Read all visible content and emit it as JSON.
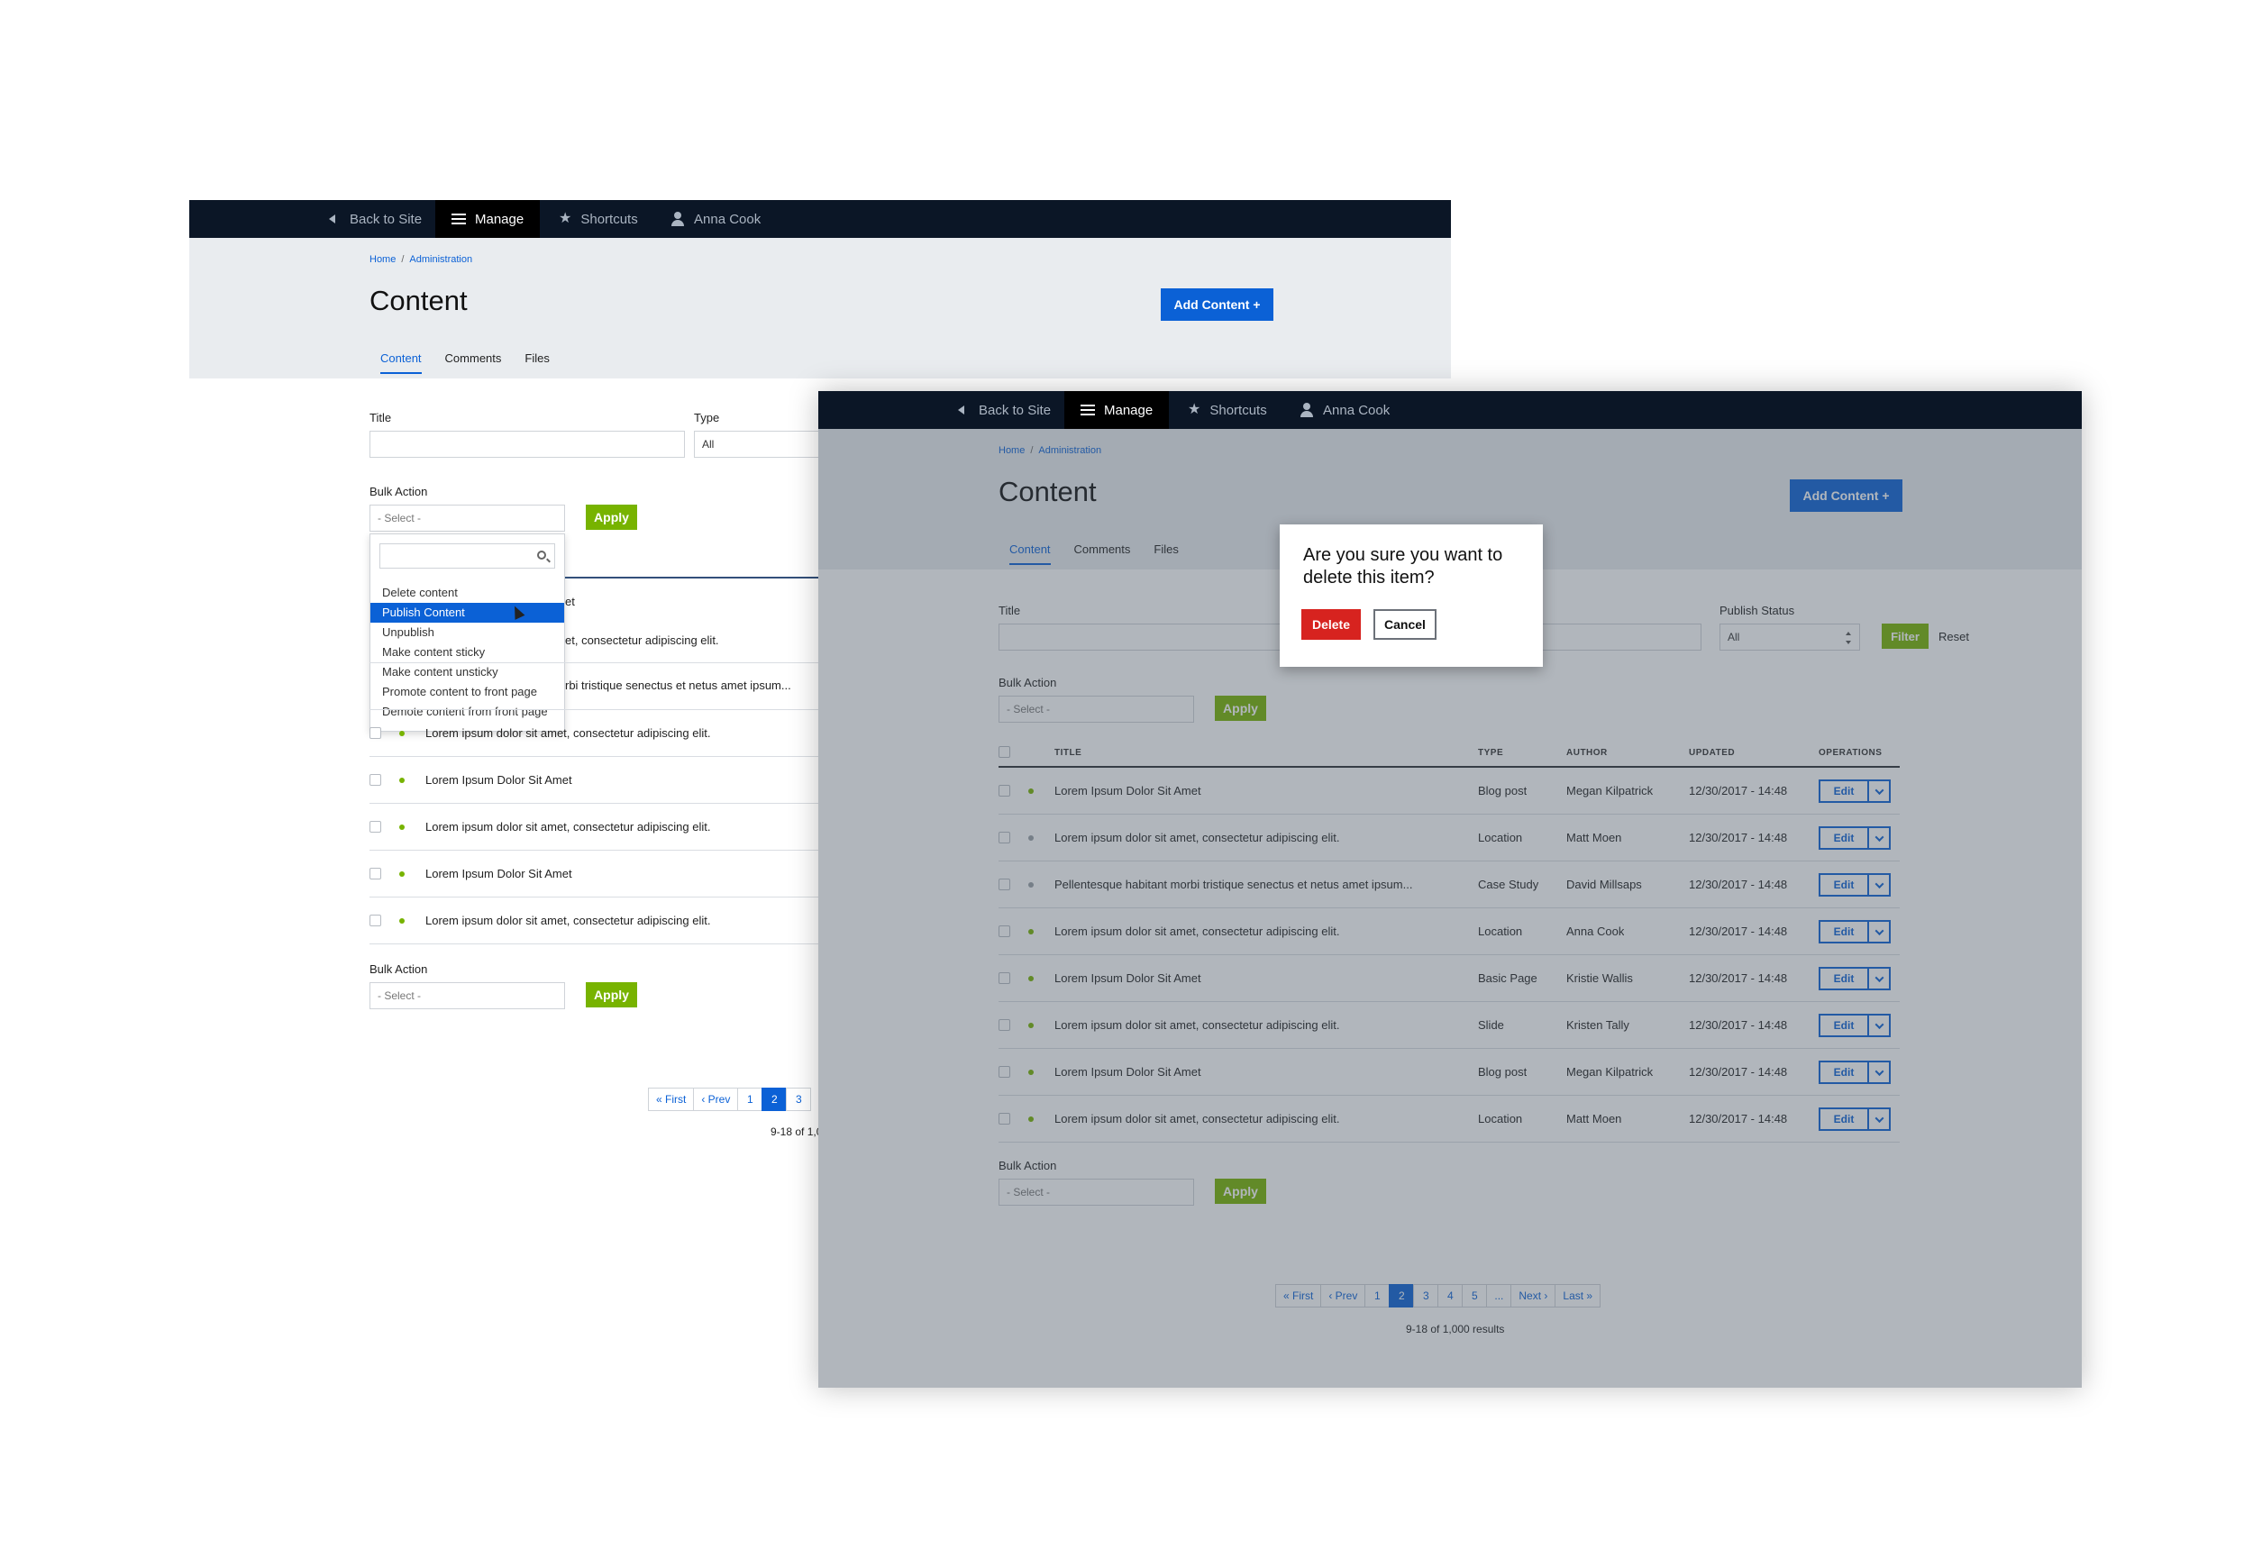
{
  "toolbar": {
    "back": "Back to Site",
    "manage": "Manage",
    "shortcuts": "Shortcuts",
    "user": "Anna Cook"
  },
  "breadcrumb": {
    "home": "Home",
    "admin": "Administration"
  },
  "page_title": "Content",
  "add_content": "Add Content +",
  "tabs": {
    "content": "Content",
    "comments": "Comments",
    "files": "Files"
  },
  "filters": {
    "title_label": "Title",
    "type_label": "Type",
    "type_value": "All",
    "status_label": "Publish Status",
    "status_value": "All",
    "filter": "Filter",
    "reset": "Reset"
  },
  "bulk": {
    "label": "Bulk Action",
    "placeholder": "- Select -",
    "apply": "Apply"
  },
  "dropdown_items": [
    "Delete content",
    "Publish Content",
    "Unpublish",
    "Make content sticky",
    "Make content unsticky",
    "Promote content to front page",
    "Demote content from front page"
  ],
  "back_rows": {
    "header_fragment": "et",
    "r1": "et, consectetur adipiscing elit.",
    "r2": "rbi tristique senectus et netus amet ipsum...",
    "r3": "Lorem ipsum dolor sit amet, consectetur adipiscing elit.",
    "r4": "Lorem Ipsum Dolor Sit Amet",
    "r5": "Lorem ipsum dolor sit amet, consectetur adipiscing elit.",
    "r6": "Lorem Ipsum Dolor Sit Amet",
    "r7": "Lorem ipsum dolor sit amet, consectetur adipiscing elit."
  },
  "back_pager": {
    "first": "« First",
    "prev": "‹ Prev",
    "p1": "1",
    "p2": "2",
    "p3": "3",
    "results": "9-18 of 1,0"
  },
  "table_headers": {
    "title": "TITLE",
    "type": "TYPE",
    "author": "AUTHOR",
    "updated": "UPDATED",
    "operations": "OPERATIONS"
  },
  "rows": [
    {
      "title": "Lorem Ipsum Dolor Sit Amet",
      "type": "Blog post",
      "author": "Megan Kilpatrick",
      "updated": "12/30/2017 - 14:48"
    },
    {
      "title": "Lorem ipsum dolor sit amet, consectetur adipiscing elit.",
      "type": "Location",
      "author": "Matt Moen",
      "updated": "12/30/2017 - 14:48"
    },
    {
      "title": "Pellentesque habitant morbi tristique senectus et netus amet ipsum...",
      "type": "Case Study",
      "author": "David Millsaps",
      "updated": "12/30/2017 - 14:48"
    },
    {
      "title": "Lorem ipsum dolor sit amet, consectetur adipiscing elit.",
      "type": "Location",
      "author": "Anna Cook",
      "updated": "12/30/2017 - 14:48"
    },
    {
      "title": "Lorem Ipsum Dolor Sit Amet",
      "type": "Basic Page",
      "author": "Kristie Wallis",
      "updated": "12/30/2017 - 14:48"
    },
    {
      "title": "Lorem ipsum dolor sit amet, consectetur adipiscing elit.",
      "type": "Slide",
      "author": "Kristen Tally",
      "updated": "12/30/2017 - 14:48"
    },
    {
      "title": "Lorem Ipsum Dolor Sit Amet",
      "type": "Blog post",
      "author": "Megan Kilpatrick",
      "updated": "12/30/2017 - 14:48"
    },
    {
      "title": "Lorem ipsum dolor sit amet, consectetur adipiscing elit.",
      "type": "Location",
      "author": "Matt Moen",
      "updated": "12/30/2017 - 14:48"
    }
  ],
  "edit_label": "Edit",
  "pager": {
    "first": "« First",
    "prev": "‹ Prev",
    "p1": "1",
    "p2": "2",
    "p3": "3",
    "p4": "4",
    "p5": "5",
    "ellipsis": "...",
    "next": "Next ›",
    "last": "Last »",
    "results": "9-18 of 1,000 results"
  },
  "modal": {
    "question": "Are you sure you want to delete this item?",
    "delete": "Delete",
    "cancel": "Cancel"
  },
  "colors": {
    "accent": "#0b61d6",
    "apply_green": "#77b300",
    "delete_red": "#d7231f",
    "toolbar": "#0b1626"
  }
}
